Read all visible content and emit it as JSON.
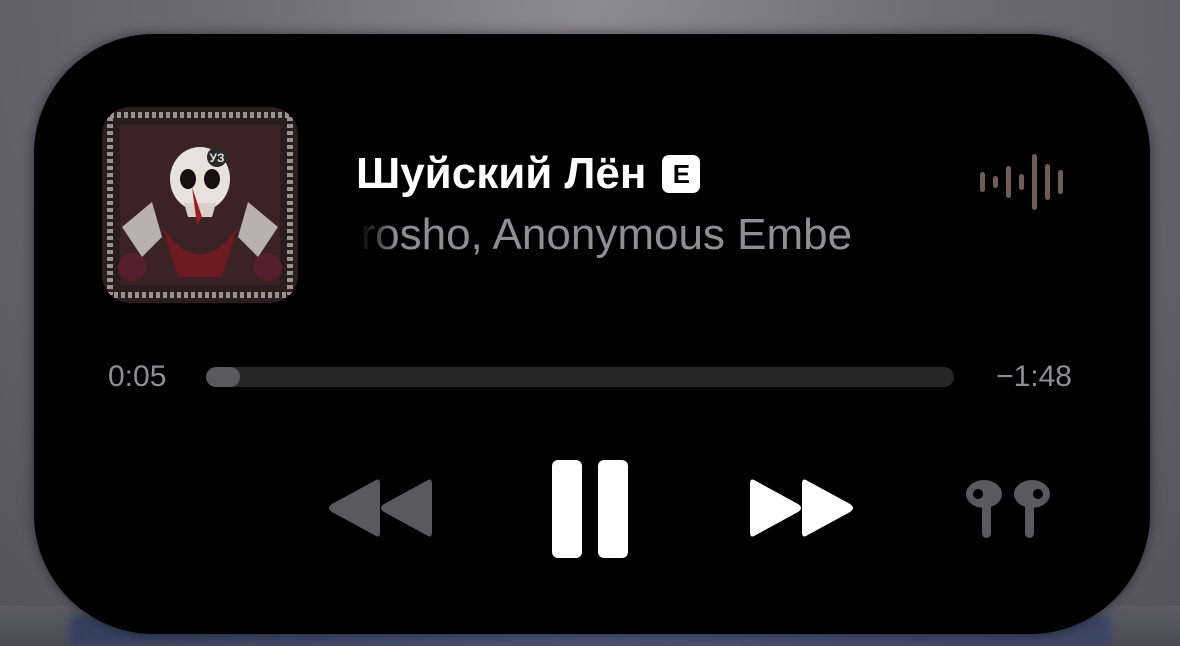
{
  "now_playing": {
    "title": "Шуйский Лён",
    "explicit_badge": "E",
    "artist": "orosho, Anonymous Embe",
    "artwork_badge": "УЗ"
  },
  "progress": {
    "elapsed": "0:05",
    "remaining": "−1:48",
    "fraction": 0.045
  },
  "controls": {
    "rewind": "rewind-icon",
    "pause": "pause-icon",
    "forward": "fast-forward-icon",
    "output": "airpods-icon"
  },
  "colors": {
    "background": "#000000",
    "title": "#ffffff",
    "secondary_text": "#8e8e93",
    "progress_track": "#262626",
    "progress_fill": "#5a5a5c",
    "waveform": "#6f5c58"
  }
}
